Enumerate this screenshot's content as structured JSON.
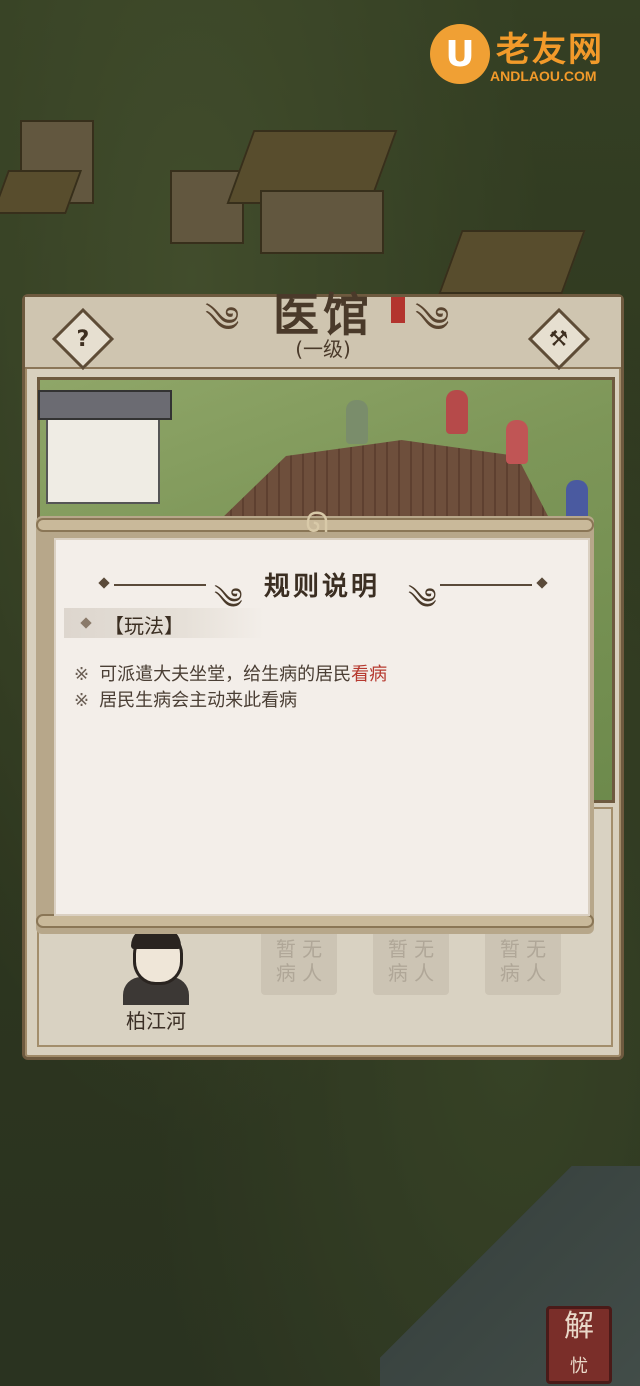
{
  "logo": {
    "badge": "U",
    "title": "老友网",
    "subtitle": "ANDLAOU.COM"
  },
  "building": {
    "title": "医馆",
    "level": "(一级)",
    "help_icon": "?",
    "build_icon": "⚒"
  },
  "rules_dialog": {
    "title": "规则说明",
    "section": "【玩法】",
    "rules": [
      {
        "mark": "※",
        "text": "可派遣大夫坐堂，给生病的居民",
        "highlight": "看病"
      },
      {
        "mark": "※",
        "text": "居民生病会主动来此看病",
        "highlight": ""
      }
    ]
  },
  "staff": {
    "doctor_name": "柏江河",
    "empty_slots": [
      {
        "line1": "暂 无",
        "line2": "病 人"
      },
      {
        "line1": "暂 无",
        "line2": "病 人"
      },
      {
        "line1": "暂 无",
        "line2": "病 人"
      }
    ]
  },
  "corner_button": {
    "line1": "解",
    "line2": "忧"
  },
  "colors": {
    "highlight": "#b6392f",
    "panel": "#d8d0be",
    "dialog": "#f3eee9",
    "logo": "#f29a2a"
  }
}
